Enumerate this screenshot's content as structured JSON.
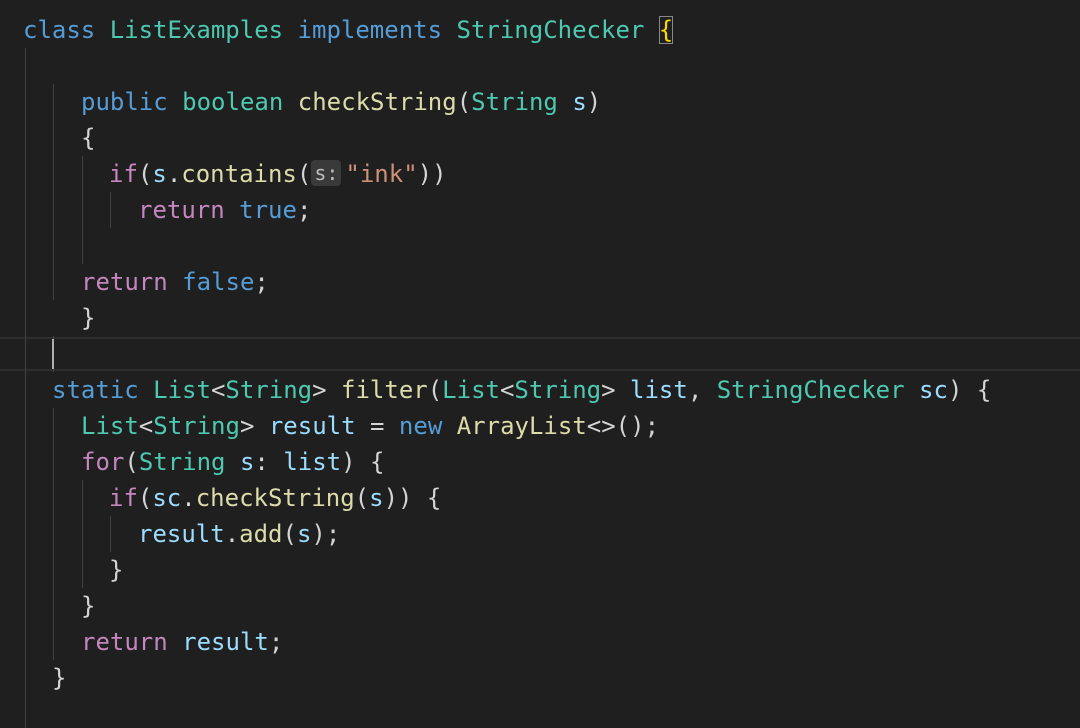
{
  "editor": {
    "theme_colors": {
      "background": "#1f1f1f",
      "keyword": "#569cd6",
      "control": "#c586c0",
      "type": "#4ec9b0",
      "function": "#dcdcaa",
      "variable": "#9cdcfe",
      "string": "#ce9178",
      "punctuation": "#d4d4d4"
    },
    "inlay_hint": "s:",
    "lines": [
      [
        [
          "kw",
          "class"
        ],
        [
          "pn",
          " "
        ],
        [
          "type",
          "ListExamples"
        ],
        [
          "pn",
          " "
        ],
        [
          "kw",
          "implements"
        ],
        [
          "pn",
          " "
        ],
        [
          "type",
          "StringChecker"
        ],
        [
          "pn",
          " "
        ],
        [
          "yb",
          "{"
        ]
      ],
      [],
      [
        [
          "kw",
          "public"
        ],
        [
          "pn",
          " "
        ],
        [
          "type",
          "boolean"
        ],
        [
          "pn",
          " "
        ],
        [
          "fn",
          "checkString"
        ],
        [
          "pn",
          "("
        ],
        [
          "type",
          "String"
        ],
        [
          "pn",
          " "
        ],
        [
          "var",
          "s"
        ],
        [
          "pn",
          ")"
        ]
      ],
      [
        [
          "pn",
          "{"
        ]
      ],
      [
        [
          "ctl",
          "if"
        ],
        [
          "pn",
          "("
        ],
        [
          "var",
          "s"
        ],
        [
          "pn",
          "."
        ],
        [
          "fn",
          "contains"
        ],
        [
          "pn",
          "("
        ],
        [
          "hint",
          "s:"
        ],
        [
          "str",
          "\"ink\""
        ],
        [
          "pn",
          "))"
        ]
      ],
      [
        [
          "ctl",
          "return"
        ],
        [
          "pn",
          " "
        ],
        [
          "kw",
          "true"
        ],
        [
          "pn",
          ";"
        ]
      ],
      [],
      [
        [
          "ctl",
          "return"
        ],
        [
          "pn",
          " "
        ],
        [
          "kw",
          "false"
        ],
        [
          "pn",
          ";"
        ]
      ],
      [
        [
          "pn",
          "}"
        ]
      ],
      [],
      [
        [
          "kw",
          "static"
        ],
        [
          "pn",
          " "
        ],
        [
          "type",
          "List"
        ],
        [
          "pn",
          "<"
        ],
        [
          "type",
          "String"
        ],
        [
          "pn",
          "> "
        ],
        [
          "fn",
          "filter"
        ],
        [
          "pn",
          "("
        ],
        [
          "type",
          "List"
        ],
        [
          "pn",
          "<"
        ],
        [
          "type",
          "String"
        ],
        [
          "pn",
          "> "
        ],
        [
          "var",
          "list"
        ],
        [
          "pn",
          ", "
        ],
        [
          "type",
          "StringChecker"
        ],
        [
          "pn",
          " "
        ],
        [
          "var",
          "sc"
        ],
        [
          "pn",
          ") {"
        ]
      ],
      [
        [
          "type",
          "List"
        ],
        [
          "pn",
          "<"
        ],
        [
          "type",
          "String"
        ],
        [
          "pn",
          "> "
        ],
        [
          "var",
          "result"
        ],
        [
          "pn",
          " = "
        ],
        [
          "kw",
          "new"
        ],
        [
          "pn",
          " "
        ],
        [
          "fn",
          "ArrayList"
        ],
        [
          "pn",
          "<>();"
        ]
      ],
      [
        [
          "ctl",
          "for"
        ],
        [
          "pn",
          "("
        ],
        [
          "type",
          "String"
        ],
        [
          "pn",
          " "
        ],
        [
          "var",
          "s"
        ],
        [
          "pn",
          ": "
        ],
        [
          "var",
          "list"
        ],
        [
          "pn",
          ") {"
        ]
      ],
      [
        [
          "ctl",
          "if"
        ],
        [
          "pn",
          "("
        ],
        [
          "var",
          "sc"
        ],
        [
          "pn",
          "."
        ],
        [
          "fn",
          "checkString"
        ],
        [
          "pn",
          "("
        ],
        [
          "var",
          "s"
        ],
        [
          "pn",
          ")) {"
        ]
      ],
      [
        [
          "var",
          "result"
        ],
        [
          "pn",
          "."
        ],
        [
          "fn",
          "add"
        ],
        [
          "pn",
          "("
        ],
        [
          "var",
          "s"
        ],
        [
          "pn",
          ");"
        ]
      ],
      [
        [
          "pn",
          "}"
        ]
      ],
      [
        [
          "pn",
          "}"
        ]
      ],
      [
        [
          "ctl",
          "return"
        ],
        [
          "pn",
          " "
        ],
        [
          "var",
          "result"
        ],
        [
          "pn",
          ";"
        ]
      ],
      [
        [
          "pn",
          "}"
        ]
      ],
      []
    ]
  }
}
